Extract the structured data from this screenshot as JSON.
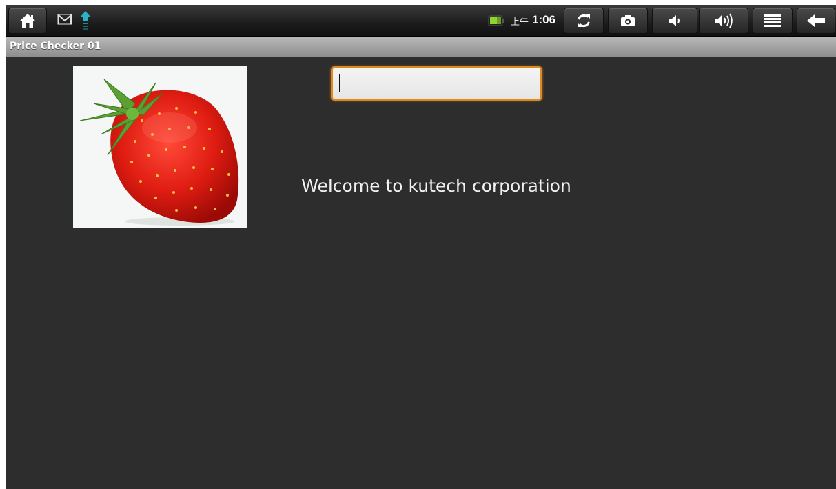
{
  "status_bar": {
    "clock_ampm": "上午",
    "clock_time": "1:06",
    "notifications": [
      "gmail-icon",
      "upload-icon"
    ],
    "buttons": [
      "home-icon",
      "sync-icon",
      "screenshot-icon",
      "volume-down-icon",
      "volume-up-icon",
      "menu-icon",
      "back-icon"
    ]
  },
  "app": {
    "title": "Price Checker 01"
  },
  "main": {
    "barcode_input_value": "",
    "welcome_text": "Welcome to kutech corporation"
  },
  "colors": {
    "background": "#2d2d2d",
    "input_focus": "#e08a1e",
    "title_bar": "#a0a0a0"
  }
}
